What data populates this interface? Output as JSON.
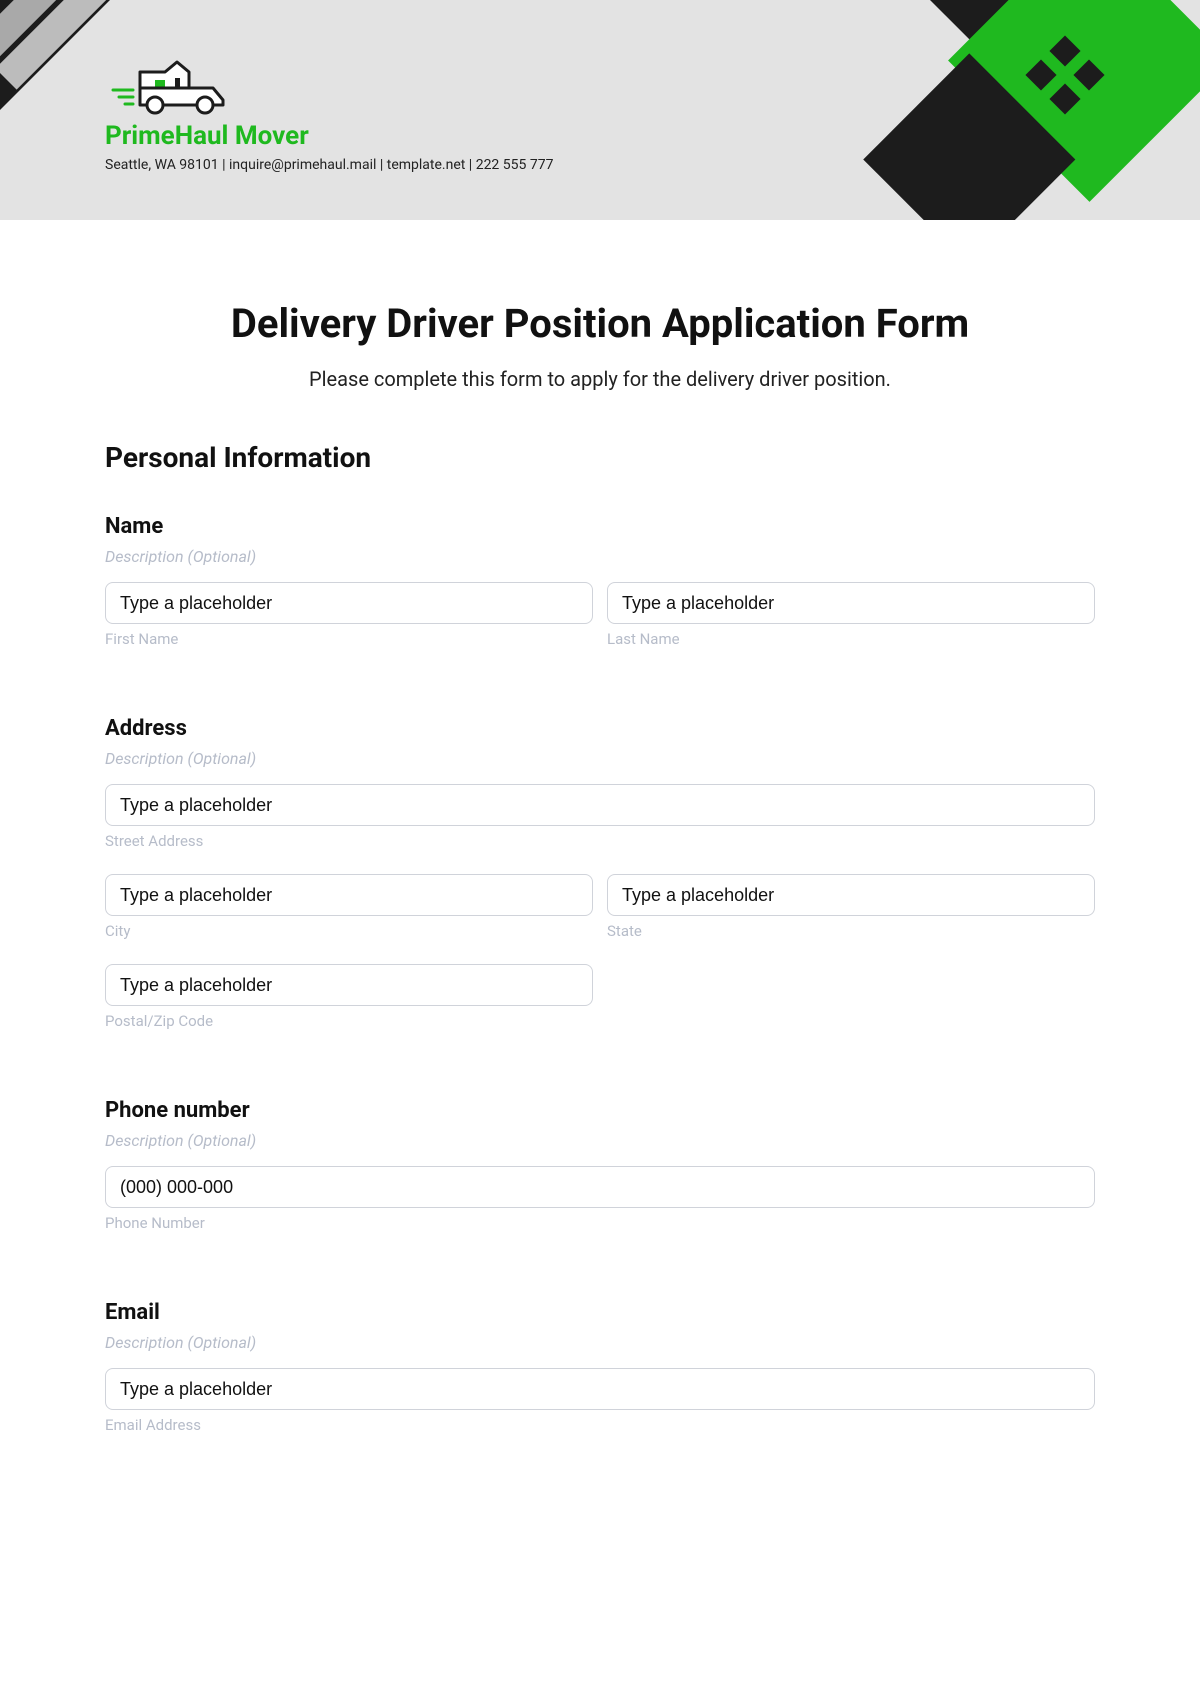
{
  "company": {
    "name": "PrimeHaul Mover",
    "contact": "Seattle, WA 98101 | inquire@primehaul.mail | template.net | 222 555 777"
  },
  "form": {
    "title": "Delivery Driver Position Application Form",
    "subtitle": "Please complete this form to apply for the delivery driver position.",
    "section": "Personal Information"
  },
  "fields": {
    "name": {
      "label": "Name",
      "desc": "Description (Optional)",
      "first_placeholder": "Type a placeholder",
      "first_sub": "First Name",
      "last_placeholder": "Type a placeholder",
      "last_sub": "Last Name"
    },
    "address": {
      "label": "Address",
      "desc": "Description (Optional)",
      "street_placeholder": "Type a placeholder",
      "street_sub": "Street Address",
      "city_placeholder": "Type a placeholder",
      "city_sub": "City",
      "state_placeholder": "Type a placeholder",
      "state_sub": "State",
      "postal_placeholder": "Type a placeholder",
      "postal_sub": "Postal/Zip Code"
    },
    "phone": {
      "label": "Phone number",
      "desc": "Description (Optional)",
      "placeholder": "(000) 000-000",
      "sub": "Phone Number"
    },
    "email": {
      "label": "Email",
      "desc": "Description (Optional)",
      "placeholder": "Type a placeholder",
      "sub": "Email Address"
    }
  }
}
